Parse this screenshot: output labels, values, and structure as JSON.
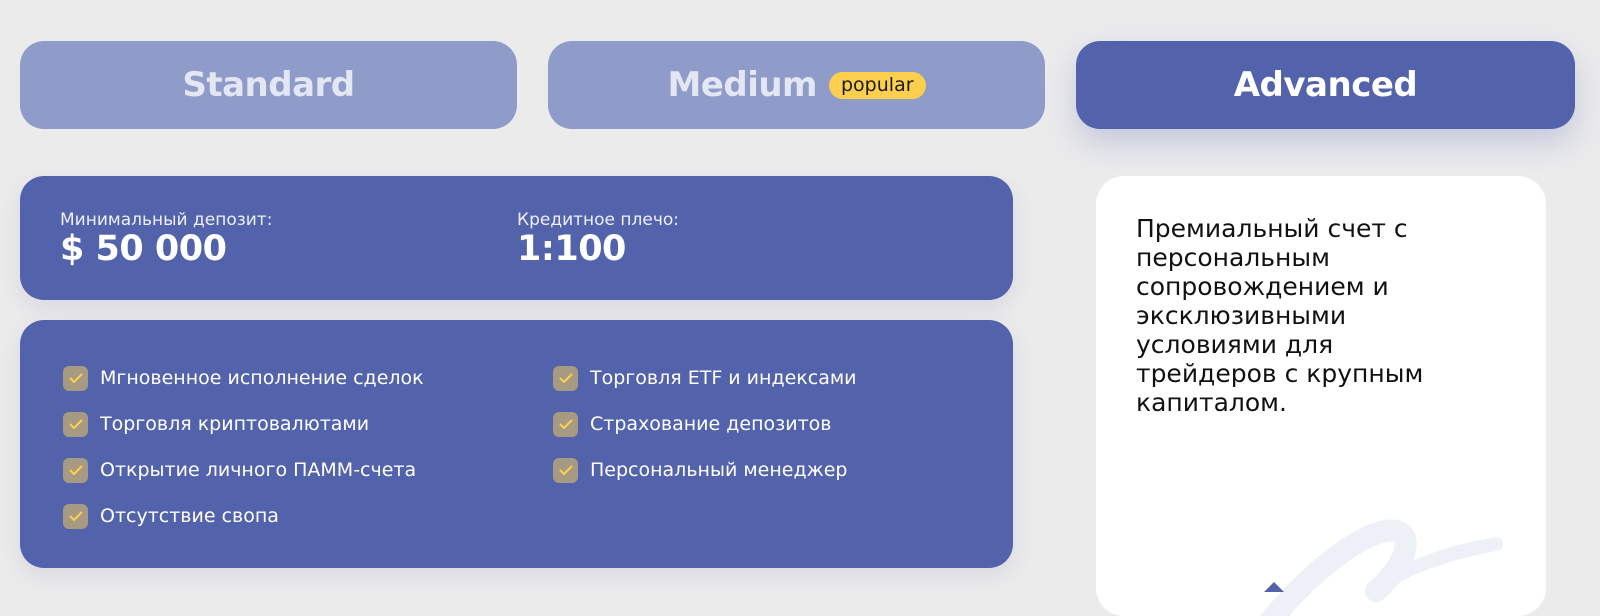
{
  "tabs": [
    {
      "label": "Standard",
      "badge": "",
      "active": false
    },
    {
      "label": "Medium",
      "badge": "popular",
      "active": false
    },
    {
      "label": "Advanced",
      "badge": "",
      "active": true
    }
  ],
  "stats": {
    "deposit_label": "Минимальный депозит:",
    "deposit_value": "$ 50 000",
    "leverage_label": "Кредитное плечо:",
    "leverage_value": "1:100"
  },
  "features": {
    "left": [
      "Мгновенное исполнение сделок",
      "Торговля криптовалютами",
      "Открытие личного ПАММ-счета",
      "Отсутствие свопа"
    ],
    "right": [
      "Торговля ETF и индексами",
      "Страхование депозитов",
      "Персональный менеджер"
    ]
  },
  "description": "Премиальный счет с персональным сопровождением и эксклюзивными условиями для трейдеров с крупным капиталом.",
  "colors": {
    "accent": "#5262ab",
    "tab_inactive": "#8f9bc8",
    "badge": "#fcd04e",
    "check_bg": "#a69a83",
    "check_mark": "#fcd04e"
  }
}
